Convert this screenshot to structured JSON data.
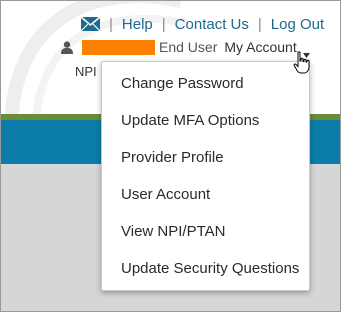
{
  "header": {
    "mail_icon": "envelope-icon",
    "links": [
      "Help",
      "Contact Us",
      "Log Out"
    ],
    "separator": "|"
  },
  "user": {
    "role": "End User",
    "account_label": "My Account",
    "person_icon": "person-icon",
    "redacted_name_color": "#ff7f00"
  },
  "npi_label": "NPI",
  "menu": {
    "items": [
      "Change Password",
      "Update MFA Options",
      "Provider Profile",
      "User Account",
      "View NPI/PTAN",
      "Update Security Questions"
    ]
  },
  "colors": {
    "link": "#1c6b8f",
    "band": "#0b7da8",
    "band_top": "#6b8c39",
    "redaction": "#ff7f00"
  }
}
